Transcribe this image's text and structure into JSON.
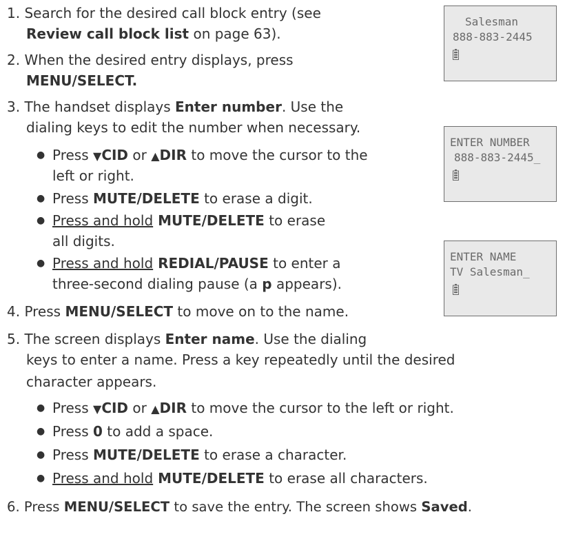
{
  "step1": {
    "a": "1. Search for the desired call block entry (see",
    "b_bold": "Review call block list",
    "b_rest": " on page 63)."
  },
  "step2": {
    "a": "2. When the desired entry displays, press",
    "b": "MENU/SELECT."
  },
  "step3": {
    "a1": "3. The handset displays ",
    "a_bold": "Enter number",
    "a2": ". Use the",
    "b": "dialing keys to edit the number when necessary."
  },
  "step3_bullets": {
    "b1_pre": "Press ",
    "b1_key1": "CID",
    "b1_or": " or ",
    "b1_key2": "DIR",
    "b1_post": " to move the cursor to the",
    "b1_line2": "left or right.",
    "b2_pre": "Press ",
    "b2_key": "MUTE/DELETE",
    "b2_post": " to erase a digit.",
    "b3_u": "Press and hold",
    "b3_key": " MUTE/DELETE",
    "b3_post": " to erase",
    "b3_line2": "all digits.",
    "b4_u": "Press and hold",
    "b4_key": " REDIAL/PAUSE",
    "b4_post": " to enter a",
    "b4_line2a": "three-second dialing pause (a ",
    "b4_line2b": "p",
    "b4_line2c": " appears)."
  },
  "step4": {
    "pre": "4. Press ",
    "key": "MENU/SELECT",
    "post": " to move on to the name."
  },
  "step5": {
    "a1": "5. The screen displays ",
    "a_bold": "Enter name",
    "a2": ". Use the dialing",
    "b": "keys to enter a name. Press a key repeatedly until the desired",
    "c": "character appears."
  },
  "step5_bullets": {
    "b1_pre": "Press ",
    "b1_key1": "CID",
    "b1_or": " or ",
    "b1_key2": "DIR",
    "b1_post": " to move the cursor to the left or right.",
    "b2_pre": "Press ",
    "b2_key": "0",
    "b2_post": " to add a space.",
    "b3_pre": "Press ",
    "b3_key": "MUTE/DELETE",
    "b3_post": " to erase a character.",
    "b4_u": "Press and hold",
    "b4_key": " MUTE/DELETE",
    "b4_post": " to erase all characters."
  },
  "step6": {
    "pre": "6. Press ",
    "key": "MENU/SELECT",
    "mid": " to save the entry. The screen shows ",
    "bold": "Saved",
    "end": "."
  },
  "screens": [
    {
      "line1": "Salesman",
      "line2": "888-883-2445"
    },
    {
      "line1": "ENTER NUMBER",
      "line2": "888-883-2445_"
    },
    {
      "line1": "ENTER NAME",
      "line2": "TV Salesman_"
    }
  ],
  "icons": {
    "battery": "battery-icon",
    "down": "down-triangle-icon",
    "up": "up-triangle-icon",
    "bullet": "bullet-icon"
  }
}
